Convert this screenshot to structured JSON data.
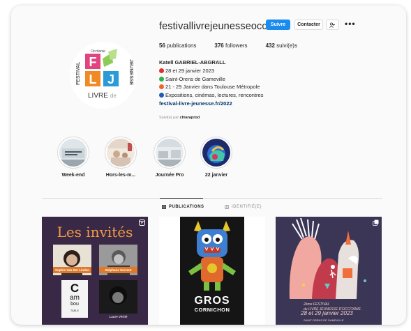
{
  "profile": {
    "username": "festivallivrejeunesseocc",
    "follow_label": "Suivre",
    "contact_label": "Contacter",
    "more_label": "•••",
    "logo_text": {
      "top_small": "Occitanie",
      "side_left": "FESTIVAL",
      "side_right": "JEUNESSE",
      "letters": [
        "F",
        "L",
        "J"
      ],
      "bottom": "LIVRE de"
    }
  },
  "stats": {
    "publications_count": "56",
    "publications_label": "publications",
    "followers_count": "376",
    "followers_label": "followers",
    "following_count": "432",
    "following_label": "suivi(e)s"
  },
  "bio": {
    "name": "Katell GABRIEL-ABGRALL",
    "lines": [
      {
        "color": "#e0302b",
        "text": "28 et 29 janvier 2023"
      },
      {
        "color": "#2fb14a",
        "text": "Saint-Orens de Gameville"
      },
      {
        "color": "#f0662a",
        "text": "21 - 29 Janvier dans Toulouse Métropole"
      },
      {
        "color": "#1a5fb4",
        "text": "Expositions, cinémas, lectures, rencontres"
      }
    ],
    "link": "festival-livre-jeunesse.fr/2022",
    "followed_by_prefix": "Suivi(e) par",
    "followed_by_user": "chiaraprod"
  },
  "highlights": [
    {
      "label": "Week-end"
    },
    {
      "label": "Hors-les-m..."
    },
    {
      "label": "Journée Pro"
    },
    {
      "label": "22 janvier"
    }
  ],
  "tabs": [
    {
      "label": "PUBLICATIONS",
      "active": true
    },
    {
      "label": "IDENTIFIÉ(E)",
      "active": false
    }
  ],
  "posts": {
    "post1": {
      "title": "Les invités",
      "names": [
        "Sophie Van Der Linden",
        "Stéphane Servant",
        "",
        "Laure Vérité"
      ],
      "book_letters": [
        "C",
        "am",
        "bou",
        "TABLE"
      ]
    },
    "post2": {
      "title_line1": "GROS",
      "title_line2": "CORNICHON"
    },
    "post3": {
      "text_lines": [
        "2ème FESTIVAL",
        "du LIVRE JEUNESSE D'OCCITANIE"
      ],
      "date": "28 et 29 janvier 2023",
      "place": "SAINT-ORENS DE GAMEVILLE"
    }
  },
  "colors": {
    "accent": "#1a8cf0",
    "link": "#00376b",
    "logo_orange": "#f08a24",
    "logo_blue": "#2a9bd6",
    "logo_pink": "#e2447f"
  }
}
